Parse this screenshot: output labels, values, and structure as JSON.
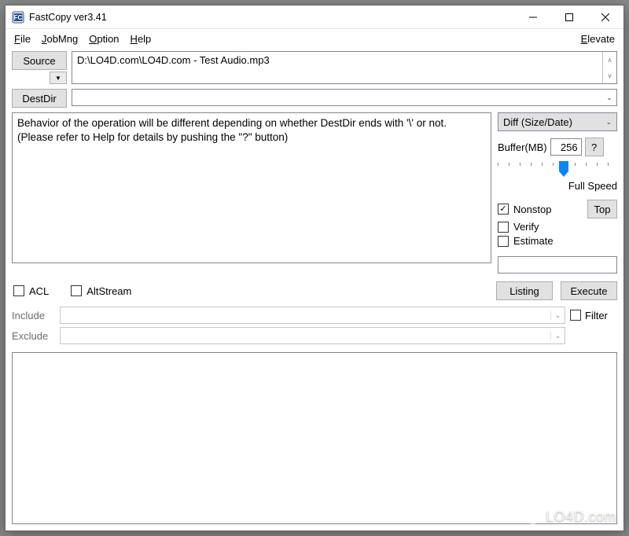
{
  "titlebar": {
    "title": "FastCopy ver3.41"
  },
  "menu": {
    "file": "File",
    "jobmng": "JobMng",
    "option": "Option",
    "help": "Help",
    "elevate": "Elevate"
  },
  "source": {
    "button": "Source",
    "value": "D:\\LO4D.com\\LO4D.com - Test Audio.mp3"
  },
  "destdir": {
    "button": "DestDir",
    "value": ""
  },
  "info": {
    "line1": "Behavior of the operation will be different depending on whether DestDir ends with '\\' or not.",
    "line2": "(Please refer to Help for details by pushing the \"?\" button)"
  },
  "side": {
    "mode": "Diff (Size/Date)",
    "buffer_label": "Buffer(MB)",
    "buffer_value": "256",
    "help_btn": "?",
    "speed_label": "Full Speed",
    "nonstop": "Nonstop",
    "verify": "Verify",
    "estimate": "Estimate",
    "top_btn": "Top",
    "checks": {
      "nonstop": true,
      "verify": false,
      "estimate": false
    }
  },
  "checks2": {
    "acl": "ACL",
    "altstream": "AltStream",
    "acl_checked": false,
    "altstream_checked": false
  },
  "actions": {
    "listing": "Listing",
    "execute": "Execute"
  },
  "filter": {
    "include_label": "Include",
    "exclude_label": "Exclude",
    "include_value": "",
    "exclude_value": "",
    "filter_label": "Filter",
    "filter_checked": false
  },
  "watermark": "LO4D.com"
}
